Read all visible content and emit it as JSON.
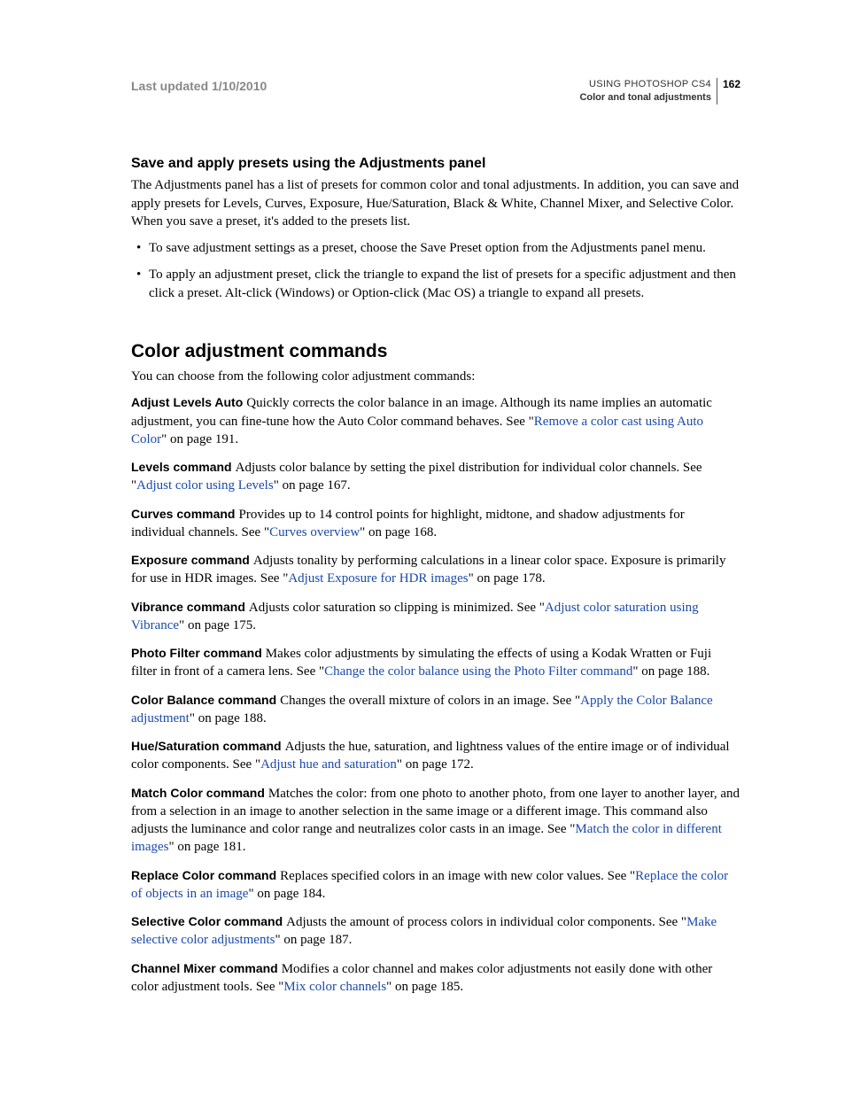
{
  "header": {
    "last_updated": "Last updated 1/10/2010",
    "doc_title": "USING PHOTOSHOP CS4",
    "chapter": "Color and tonal adjustments",
    "page_num": "162"
  },
  "section1": {
    "heading": "Save and apply presets using the Adjustments panel",
    "intro": "The Adjustments panel has a list of presets for common color and tonal adjustments. In addition, you can save and apply presets for Levels, Curves, Exposure, Hue/Saturation, Black & White, Channel Mixer, and Selective Color. When you save a preset, it's added to the presets list.",
    "bullets": [
      "To save adjustment settings as a preset, choose the Save Preset option from the Adjustments panel menu.",
      "To apply an adjustment preset, click the triangle to expand the list of presets for a specific adjustment and then click a preset. Alt-click (Windows) or Option-click (Mac OS) a triangle to expand all presets."
    ]
  },
  "section2": {
    "heading": "Color adjustment commands",
    "intro": "You can choose from the following color adjustment commands:",
    "commands": [
      {
        "name": "Adjust Levels Auto",
        "pre": "Quickly corrects the color balance in an image. Although its name implies an automatic adjustment, you can fine-tune how the Auto Color command behaves. See \"",
        "link": "Remove a color cast using Auto Color",
        "post": "\" on page 191."
      },
      {
        "name": "Levels command",
        "pre": "Adjusts color balance by setting the pixel distribution for individual color channels. See \"",
        "link": "Adjust color using Levels",
        "post": "\" on page 167."
      },
      {
        "name": "Curves command",
        "pre": "Provides up to 14 control points for highlight, midtone, and shadow adjustments for individual channels. See \"",
        "link": "Curves overview",
        "post": "\" on page 168."
      },
      {
        "name": "Exposure command",
        "pre": "Adjusts tonality by performing calculations in a linear color space. Exposure is primarily for use in HDR images. See \"",
        "link": "Adjust Exposure for HDR images",
        "post": "\" on page 178."
      },
      {
        "name": "Vibrance command",
        "pre": "Adjusts color saturation so clipping is minimized. See \"",
        "link": "Adjust color saturation using Vibrance",
        "post": "\" on page 175."
      },
      {
        "name": "Photo Filter command",
        "pre": "Makes color adjustments by simulating the effects of using a Kodak Wratten or Fuji filter in front of a camera lens. See \"",
        "link": "Change the color balance using the Photo Filter command",
        "post": "\" on page 188."
      },
      {
        "name": "Color Balance command",
        "pre": "Changes the overall mixture of colors in an image. See \"",
        "link": "Apply the Color Balance adjustment",
        "post": "\" on page 188."
      },
      {
        "name": "Hue/Saturation command",
        "pre": "Adjusts the hue, saturation, and lightness values of the entire image or of individual color components. See \"",
        "link": "Adjust hue and saturation",
        "post": "\" on page 172."
      },
      {
        "name": "Match Color command",
        "pre": "Matches the color: from one photo to another photo, from one layer to another layer, and from a selection in an image to another selection in the same image or a different image. This command also adjusts the luminance and color range and neutralizes color casts in an image. See \"",
        "link": "Match the color in different images",
        "post": "\" on page 181."
      },
      {
        "name": "Replace Color command",
        "pre": "Replaces specified colors in an image with new color values. See \"",
        "link": "Replace the color of objects in an image",
        "post": "\" on page 184."
      },
      {
        "name": "Selective Color command",
        "pre": "Adjusts the amount of process colors in individual color components. See \"",
        "link": "Make selective color adjustments",
        "post": "\" on page 187."
      },
      {
        "name": "Channel Mixer command",
        "pre": "Modifies a color channel and makes color adjustments not easily done with other color adjustment tools. See \"",
        "link": "Mix color channels",
        "post": "\" on page 185."
      }
    ]
  }
}
